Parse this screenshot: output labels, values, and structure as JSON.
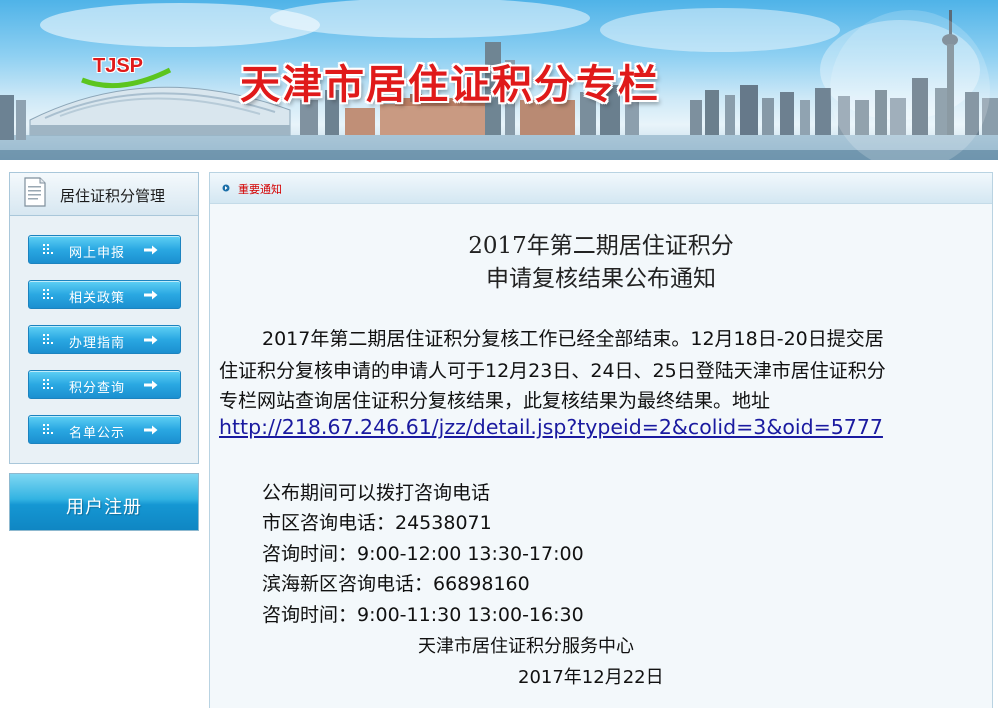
{
  "banner": {
    "logo": "TJSP",
    "title": "天津市居住证积分专栏"
  },
  "sidebar": {
    "title": "居住证积分管理",
    "items": [
      {
        "label": "网上申报"
      },
      {
        "label": "相关政策"
      },
      {
        "label": "办理指南"
      },
      {
        "label": "积分查询"
      },
      {
        "label": "名单公示"
      }
    ],
    "register_label": "用户注册"
  },
  "main": {
    "header_label": "重要通知",
    "title_line1": "2017年第二期居住证积分",
    "title_line2": "申请复核结果公布通知",
    "para_line1": "2017年第二期居住证积分复核工作已经全部结束。12月18日-20日提交居",
    "para_line2": "住证积分复核申请的申请人可于12月23日、24日、25日登陆天津市居住证积分",
    "para_line3": "专栏网站查询居住证积分复核结果，此复核结果为最终结果。地址",
    "link": "http://218.67.246.61/jzz/detail.jsp?typeid=2&colid=3&oid=5777",
    "contact_intro": "公布期间可以拨打咨询电话",
    "city_phone": "市区咨询电话：24538071",
    "city_hours": "咨询时间：9:00-12:00  13:30-17:00",
    "binhai_phone": "滨海新区咨询电话：66898160",
    "binhai_hours": "咨询时间：9:00-11:30  13:00-16:30",
    "org": "天津市居住证积分服务中心",
    "date": "2017年12月22日"
  },
  "colors": {
    "title_red": "#e01a1a",
    "button_blue": "#2aa8e2",
    "link_blue": "#1a1aa0",
    "notice_red": "#d40000"
  }
}
